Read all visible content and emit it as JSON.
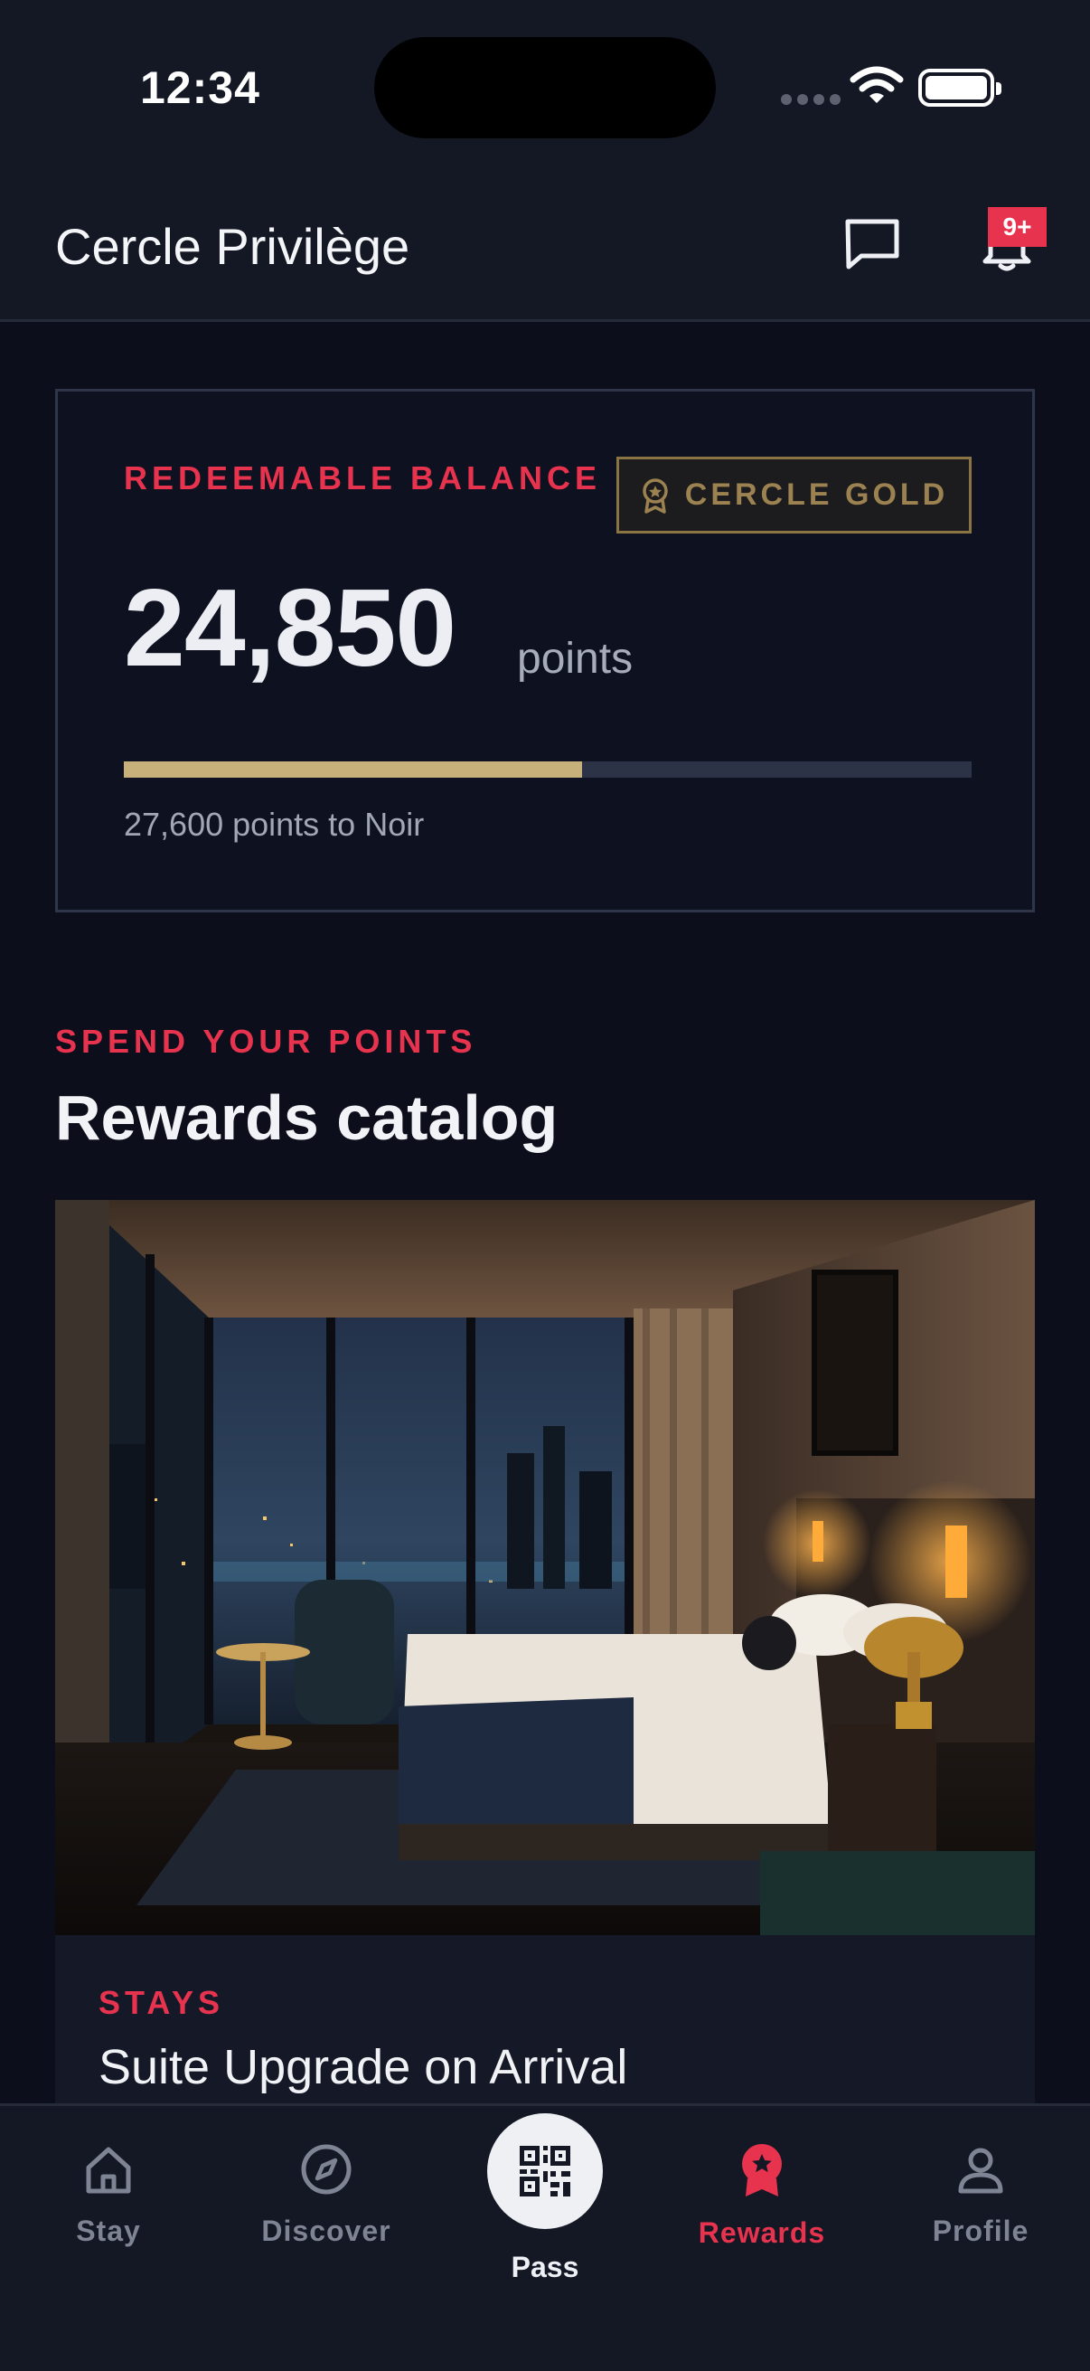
{
  "status_bar": {
    "time": "12:34"
  },
  "header": {
    "title": "Cercle Privilège",
    "notification_badge": "9+"
  },
  "balance": {
    "label": "REDEEMABLE BALANCE",
    "tier": "CERCLE GOLD",
    "points": "24,850",
    "unit": "points",
    "progress_fraction": 0.54,
    "progress_text": "27,600 points to Noir"
  },
  "section": {
    "kicker": "SPEND YOUR POINTS",
    "title": "Rewards catalog"
  },
  "reward": {
    "category": "STAYS",
    "title": "Suite Upgrade on Arrival",
    "image_alt": "hotel-suite-night-city-view"
  },
  "nav": {
    "items": [
      {
        "label": "Stay",
        "icon": "home-icon"
      },
      {
        "label": "Discover",
        "icon": "compass-icon"
      },
      {
        "label": "Pass",
        "icon": "qr-code-icon"
      },
      {
        "label": "Rewards",
        "icon": "ribbon-star-icon"
      },
      {
        "label": "Profile",
        "icon": "user-icon"
      }
    ]
  },
  "colors": {
    "accent": "#e8334f",
    "gold": "#c8b07a",
    "background": "#0c0f1b",
    "surface": "#141824"
  }
}
